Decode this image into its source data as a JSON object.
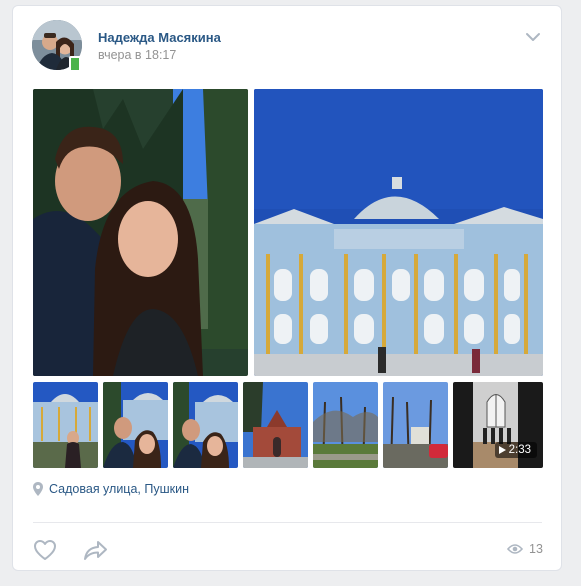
{
  "post": {
    "author": "Надежда Масякина",
    "time": "вчера в 18:17",
    "location": "Садовая улица, Пушкин",
    "views": "13",
    "video_duration": "2:33"
  },
  "icons": {
    "menu": "chevron-down-icon",
    "location": "location-pin-icon",
    "like": "heart-icon",
    "share": "share-arrow-icon",
    "views": "eye-icon",
    "play": "play-icon"
  },
  "colors": {
    "link": "#2a5885",
    "muted": "#939393",
    "icon": "#aeb7c2",
    "online": "#4bb34b",
    "sky": "#1f4fb5",
    "palace": "#9fc0dd"
  }
}
